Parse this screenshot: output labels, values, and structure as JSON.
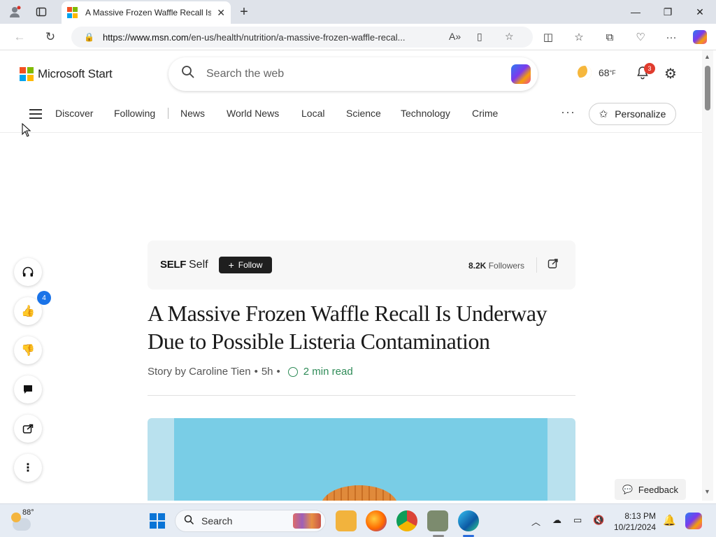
{
  "browser": {
    "tab_title": "A Massive Frozen Waffle Recall Is",
    "url_host": "https://www.msn.com",
    "url_path": "/en-us/health/nutrition/a-massive-frozen-waffle-recal...",
    "window_controls": [
      "minimize",
      "restore",
      "close"
    ]
  },
  "header": {
    "brand": "Microsoft Start",
    "search_placeholder": "Search the web",
    "weather_temp": "68",
    "weather_unit": "°F",
    "notification_count": "3"
  },
  "nav": {
    "items": [
      "Discover",
      "Following",
      "News",
      "World News",
      "Local",
      "Science",
      "Technology",
      "Crime"
    ],
    "more": "···",
    "personalize": "Personalize"
  },
  "rail": {
    "like_count": "4"
  },
  "article": {
    "publisher_logo": "SELF",
    "publisher_name": "Self",
    "follow_label": "Follow",
    "followers_count": "8.2K",
    "followers_label": "Followers",
    "headline": "A Massive Frozen Waffle Recall Is Underway Due to Possible Listeria Contamination",
    "byline": "Story by Caroline Tien",
    "age": "5h",
    "read_time": "2 min read"
  },
  "feedback": "Feedback",
  "taskbar": {
    "weather_temp": "88°",
    "search_label": "Search",
    "time": "8:13 PM",
    "date": "10/21/2024"
  },
  "colors": {
    "accent_green": "#2e8b57",
    "follow_button": "#1f1f1f",
    "badge_blue": "#1a73e8",
    "notif_red": "#e03c2e"
  }
}
